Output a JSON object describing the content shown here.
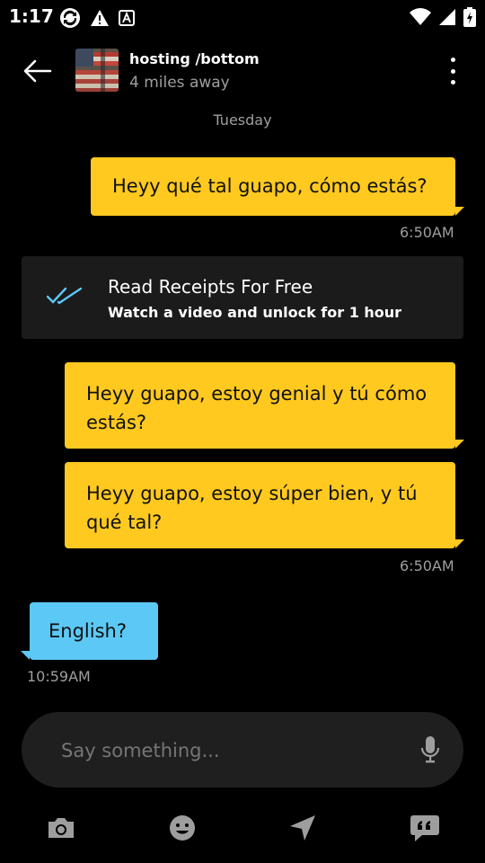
{
  "status_bar": {
    "time": "1:17"
  },
  "header": {
    "back_icon": "arrow-left-icon",
    "name": "hosting /bottom",
    "distance": "4 miles away",
    "more_icon": "more-vertical-icon"
  },
  "thread": {
    "day_label": "Tuesday",
    "messages": [
      {
        "side": "out",
        "text": "Heyy qué tal guapo, cómo estás?"
      },
      {
        "side": "out",
        "text": "Heyy guapo, estoy genial y tú cómo estás?"
      },
      {
        "side": "out",
        "text": "Heyy guapo, estoy súper bien, y tú qué tal?"
      },
      {
        "side": "in",
        "text": "English?"
      }
    ],
    "timestamps": [
      "6:50AM",
      "6:50AM",
      "10:59AM"
    ]
  },
  "receipt_banner": {
    "icon": "double-check-icon",
    "title": "Read Receipts For Free",
    "subtitle": "Watch a video and unlock for 1 hour"
  },
  "composer": {
    "placeholder": "Say something...",
    "mic_icon": "microphone-icon"
  },
  "bottom_bar": {
    "items": [
      "camera-icon",
      "emoji-icon",
      "location-send-icon",
      "saved-phrases-icon"
    ]
  },
  "colors": {
    "outgoing_bubble": "#ffc91f",
    "incoming_bubble": "#5cc8f5",
    "banner_bg": "#1b1b1b",
    "check_accent": "#5cc8f5"
  }
}
